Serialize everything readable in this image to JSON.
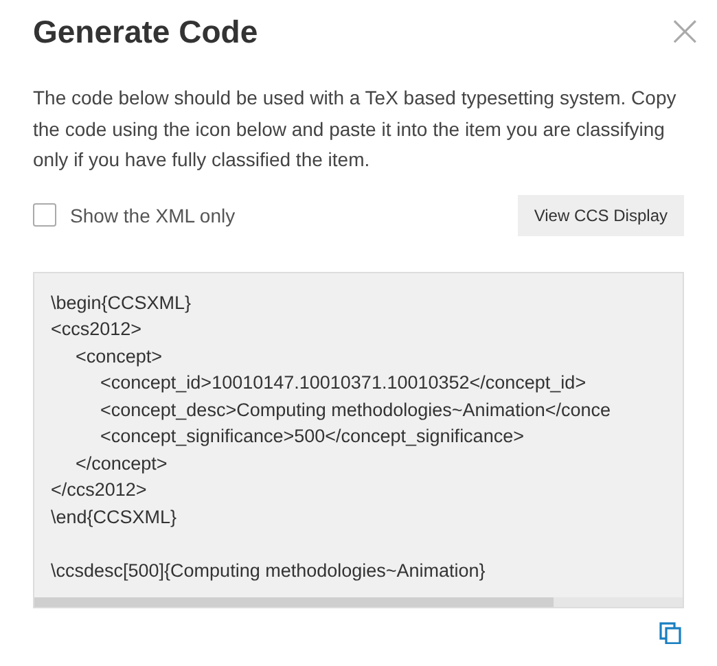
{
  "dialog": {
    "title": "Generate Code",
    "close_label": "×",
    "description": "The code below should be used with a TeX based typesetting system. Copy the code using the icon below and paste it into the item you are classifying only if you have fully classified the item.",
    "xml_only": {
      "label": "Show the XML only",
      "checked": false
    },
    "view_button": "View CCS Display",
    "code": {
      "lines": [
        {
          "text": "\\begin{CCSXML}"
        },
        {
          "text": "<ccs2012>",
          "children": [
            {
              "text": "<concept>",
              "children": [
                {
                  "text": "<concept_id>10010147.10010371.10010352</concept_id>"
                },
                {
                  "text": "<concept_desc>Computing methodologies~Animation</conce"
                },
                {
                  "text": "<concept_significance>500</concept_significance>"
                }
              ]
            },
            {
              "text": "</concept>"
            }
          ]
        },
        {
          "text": "</ccs2012>"
        },
        {
          "text": "\\end{CCSXML}"
        }
      ],
      "ccsdesc": "\\ccsdesc[500]{Computing methodologies~Animation}"
    }
  }
}
